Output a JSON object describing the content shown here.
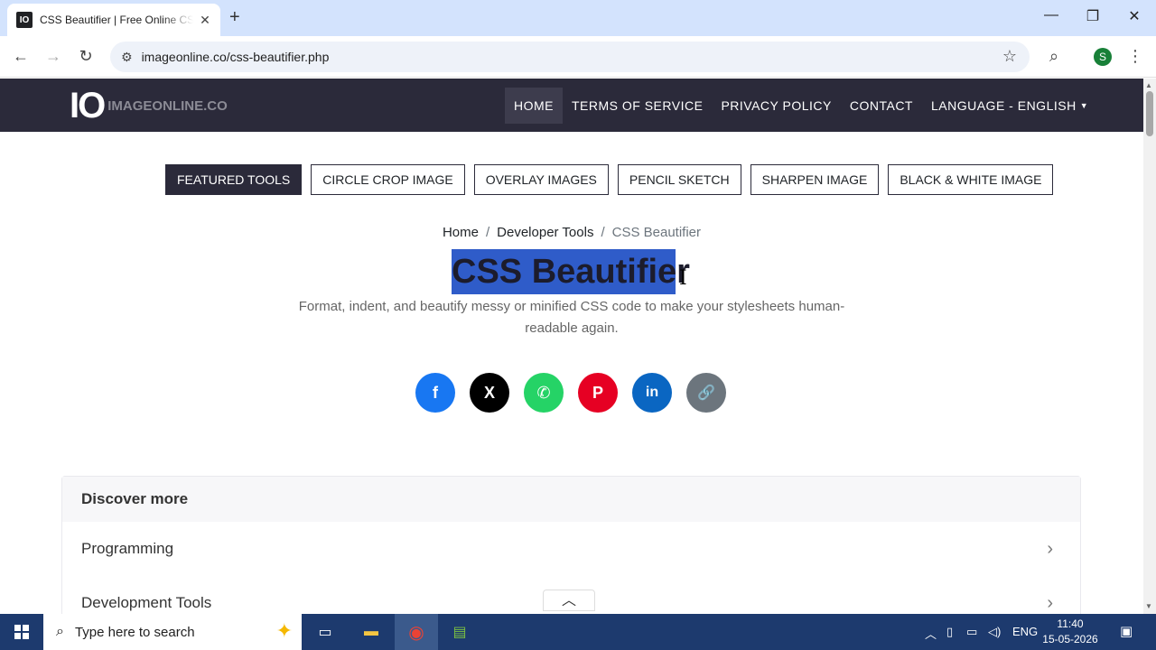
{
  "browser": {
    "tab_title": "CSS Beautifier | Free Online CSS Beautifier",
    "tab_favicon": "IO",
    "url": "imageonline.co/css-beautifier.php",
    "profile_initial": "S"
  },
  "site": {
    "logo_mark": "IO",
    "logo_text": "IMAGEONLINE.CO",
    "nav": [
      {
        "label": "HOME"
      },
      {
        "label": "TERMS OF SERVICE"
      },
      {
        "label": "PRIVACY POLICY"
      },
      {
        "label": "CONTACT"
      },
      {
        "label": "LANGUAGE - ENGLISH"
      }
    ]
  },
  "tools": [
    {
      "label": "FEATURED TOOLS"
    },
    {
      "label": "CIRCLE CROP IMAGE"
    },
    {
      "label": "OVERLAY IMAGES"
    },
    {
      "label": "PENCIL SKETCH"
    },
    {
      "label": "SHARPEN IMAGE"
    },
    {
      "label": "BLACK & WHITE IMAGE"
    }
  ],
  "breadcrumb": {
    "home": "Home",
    "section": "Developer Tools",
    "current": "CSS Beautifier",
    "separator": "/"
  },
  "page": {
    "title": "CSS Beautifier",
    "subtitle": "Format, indent, and beautify messy or minified CSS code to make your stylesheets human-readable again."
  },
  "share": [
    {
      "icon": "facebook-icon",
      "glyph": "f",
      "color": "#1877f2"
    },
    {
      "icon": "x-icon",
      "glyph": "X",
      "color": "#000000"
    },
    {
      "icon": "whatsapp-icon",
      "glyph": "✆",
      "color": "#25d366"
    },
    {
      "icon": "pinterest-icon",
      "glyph": "P",
      "color": "#e60023"
    },
    {
      "icon": "linkedin-icon",
      "glyph": "in",
      "color": "#0a66c2"
    },
    {
      "icon": "link-icon",
      "glyph": "🔗",
      "color": "#6c757d"
    }
  ],
  "discover": {
    "heading": "Discover more",
    "items": [
      {
        "label": "Programming"
      },
      {
        "label": "Development Tools"
      }
    ]
  },
  "taskbar": {
    "search_placeholder": "Type here to search",
    "language": "ENG",
    "time": "11:40",
    "date": "15-05-2026"
  }
}
